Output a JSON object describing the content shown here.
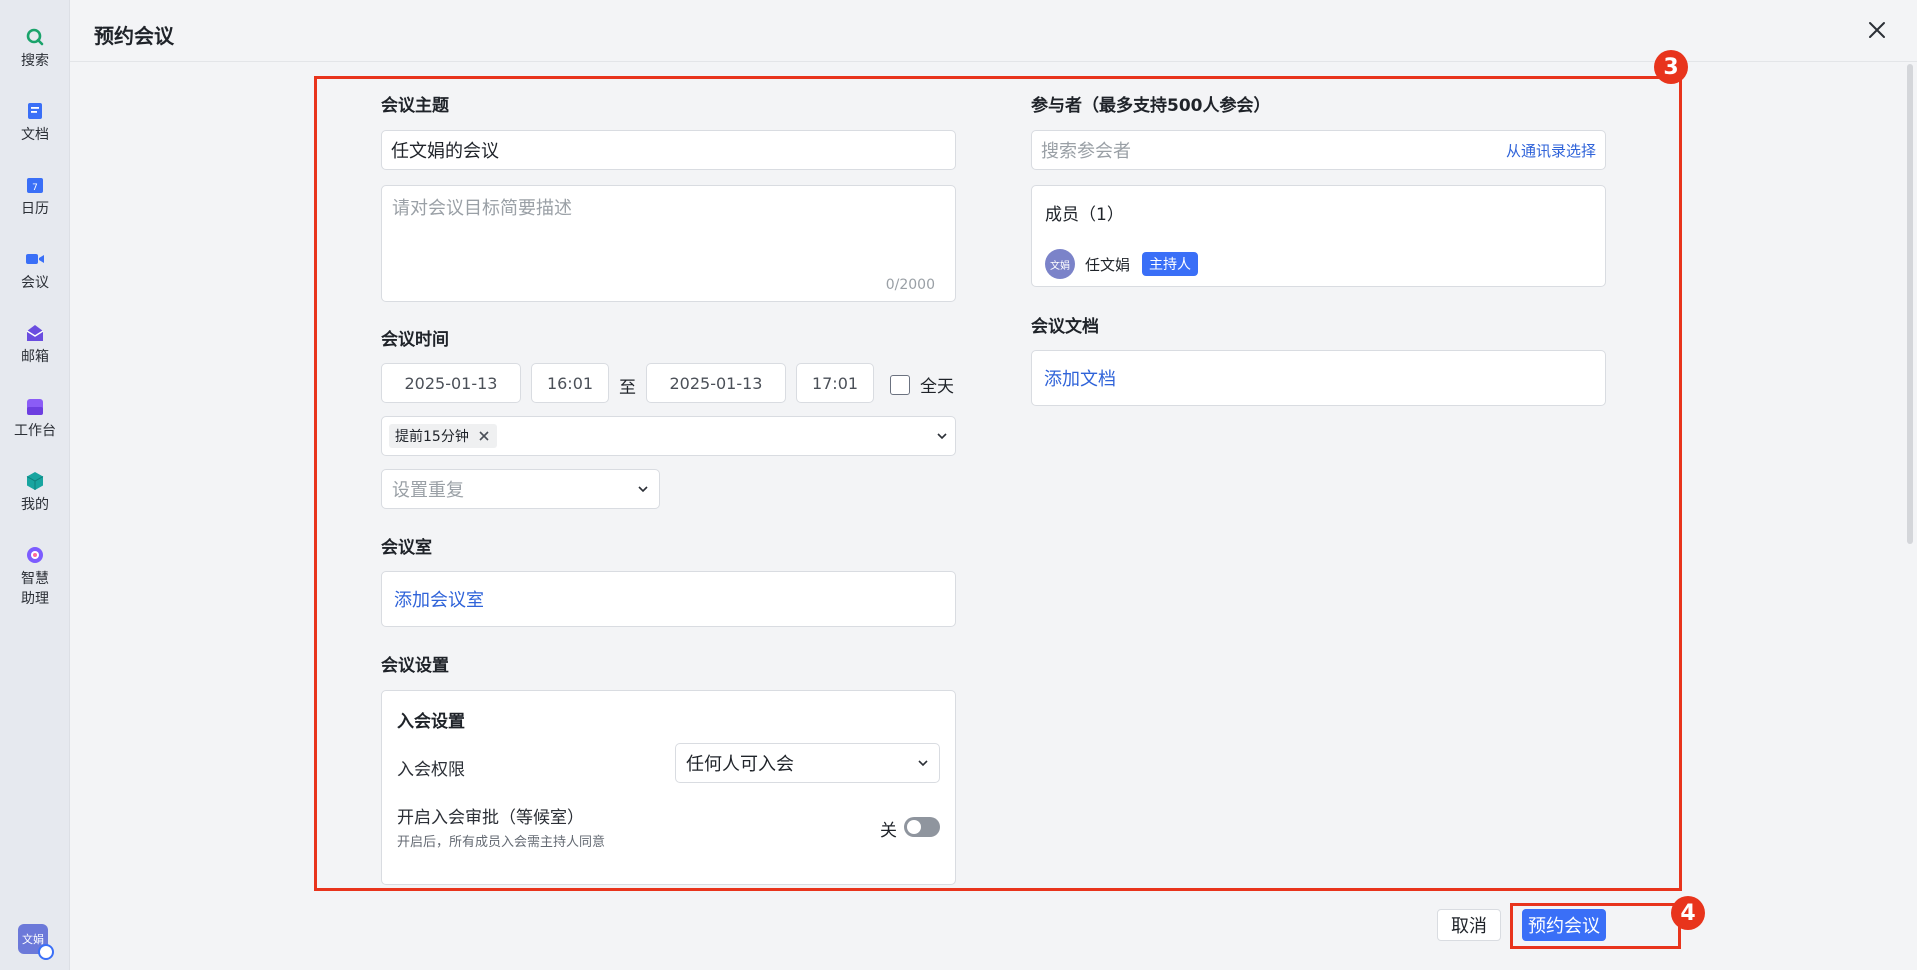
{
  "sidebar": {
    "items": [
      {
        "label": "搜索",
        "icon": "search-icon"
      },
      {
        "label": "文档",
        "icon": "document-icon"
      },
      {
        "label": "日历",
        "icon": "calendar-icon"
      },
      {
        "label": "会议",
        "icon": "video-meeting-icon"
      },
      {
        "label": "邮箱",
        "icon": "mail-icon"
      },
      {
        "label": "工作台",
        "icon": "workbench-icon"
      },
      {
        "label": "我的",
        "icon": "cube-icon"
      },
      {
        "label": "智慧\n助理",
        "icon": "assistant-icon"
      }
    ],
    "user_avatar": "文娟"
  },
  "header": {
    "title": "预约会议"
  },
  "topic": {
    "label": "会议主题",
    "value": "任文娟的会议"
  },
  "description": {
    "placeholder": "请对会议目标简要描述",
    "counter": "0/2000"
  },
  "time": {
    "label": "会议时间",
    "start_date": "2025-01-13",
    "start_time": "16:01",
    "to": "至",
    "end_date": "2025-01-13",
    "end_time": "17:01",
    "all_day": "全天",
    "reminder_tag": "提前15分钟",
    "repeat_placeholder": "设置重复"
  },
  "room": {
    "label": "会议室",
    "add_link": "添加会议室"
  },
  "settings": {
    "label": "会议设置",
    "join_title": "入会设置",
    "permission_label": "入会权限",
    "permission_value": "任何人可入会",
    "approval_title": "开启入会审批（等候室）",
    "approval_desc": "开启后，所有成员入会需主持人同意",
    "approval_state": "关"
  },
  "participants": {
    "label": "参与者（最多支持500人参会）",
    "search_placeholder": "搜索参会者",
    "contacts_link": "从通讯录选择",
    "members_title": "成员（1）",
    "member_avatar": "文娟",
    "member_name": "任文娟",
    "host_badge": "主持人"
  },
  "docs": {
    "label": "会议文档",
    "add_link": "添加文档"
  },
  "footer": {
    "cancel": "取消",
    "submit": "预约会议"
  },
  "annotations": {
    "step3": "3",
    "step4": "4"
  },
  "colors": {
    "accent": "#3a6ff7",
    "annotation": "#e8341c",
    "link": "#2f63d9"
  }
}
